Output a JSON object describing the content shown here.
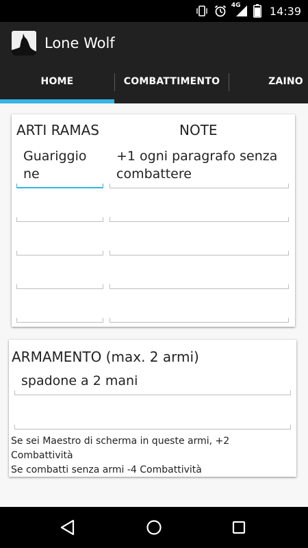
{
  "status_bar": {
    "time": "14:39",
    "network_label": "4G",
    "icons": [
      "vibrate-icon",
      "alarm-icon",
      "signal-icon",
      "battery-icon"
    ]
  },
  "app_bar": {
    "title": "Lone Wolf",
    "logo_icon": "wolf-logo-icon"
  },
  "tabs": [
    {
      "label": "HOME",
      "selected": true
    },
    {
      "label": "COMBATTIMENTO",
      "selected": false
    },
    {
      "label": "ZAINO",
      "selected": false
    }
  ],
  "arti_card": {
    "header_left": "ARTI RAMAS",
    "header_right": "NOTE",
    "rows": [
      {
        "arte": "Guariggione",
        "arte_display_line1": "Guariggio",
        "arte_display_line2": "ne",
        "note": "+1 ogni paragrafo senza combattere",
        "note_line1": "+1 ogni paragrafo senza",
        "note_line2": "combattere"
      },
      {
        "arte": "",
        "note": ""
      },
      {
        "arte": "",
        "note": ""
      },
      {
        "arte": "",
        "note": ""
      },
      {
        "arte": "",
        "note": ""
      }
    ]
  },
  "armamento_card": {
    "header": "ARMAMENTO (max. 2 armi)",
    "weapons": [
      "spadone a 2 mani",
      ""
    ],
    "info_lines": [
      "Se sei Maestro di scherma in queste armi, +2",
      "Combattività",
      "Se combatti senza armi -4 Combattività"
    ]
  },
  "nav_bar": {
    "buttons": [
      "back-icon",
      "home-icon",
      "recents-icon"
    ]
  },
  "colors": {
    "accent": "#35b5e5",
    "bar_background": "#212121",
    "status_background": "#000000"
  }
}
